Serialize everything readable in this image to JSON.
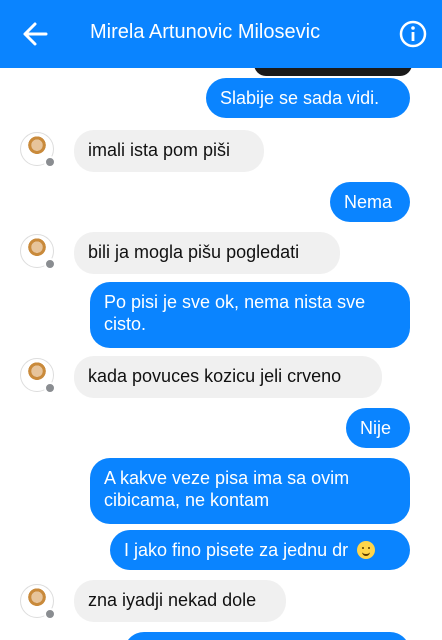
{
  "header": {
    "title": "Mirela Artunovic Milosevic",
    "back_icon": "back-arrow-icon",
    "info_icon": "info-icon",
    "bg_color": "#0a84ff"
  },
  "messages": [
    {
      "dir": "out",
      "text": "Slabije se sada vidi."
    },
    {
      "dir": "in",
      "text": "imali ista pom piši"
    },
    {
      "dir": "out",
      "text": "Nema"
    },
    {
      "dir": "in",
      "text": "bili ja mogla pišu pogledati"
    },
    {
      "dir": "out",
      "line1": "Po pisi je sve ok, nema nista sve",
      "line2": "cisto."
    },
    {
      "dir": "in",
      "text": "kada povuces kozicu jeli crveno"
    },
    {
      "dir": "out",
      "text": "Nije"
    },
    {
      "dir": "out",
      "line1": "A kakve veze pisa ima sa ovim",
      "line2": "cibicama, ne kontam"
    },
    {
      "dir": "out",
      "text": "I jako fino pisete za jednu dr",
      "emoji": "smiley-icon"
    },
    {
      "dir": "in",
      "text": "zna iyadji nekad dole"
    }
  ],
  "colors": {
    "outgoing": "#0a84ff",
    "incoming": "#f0f0f0"
  }
}
